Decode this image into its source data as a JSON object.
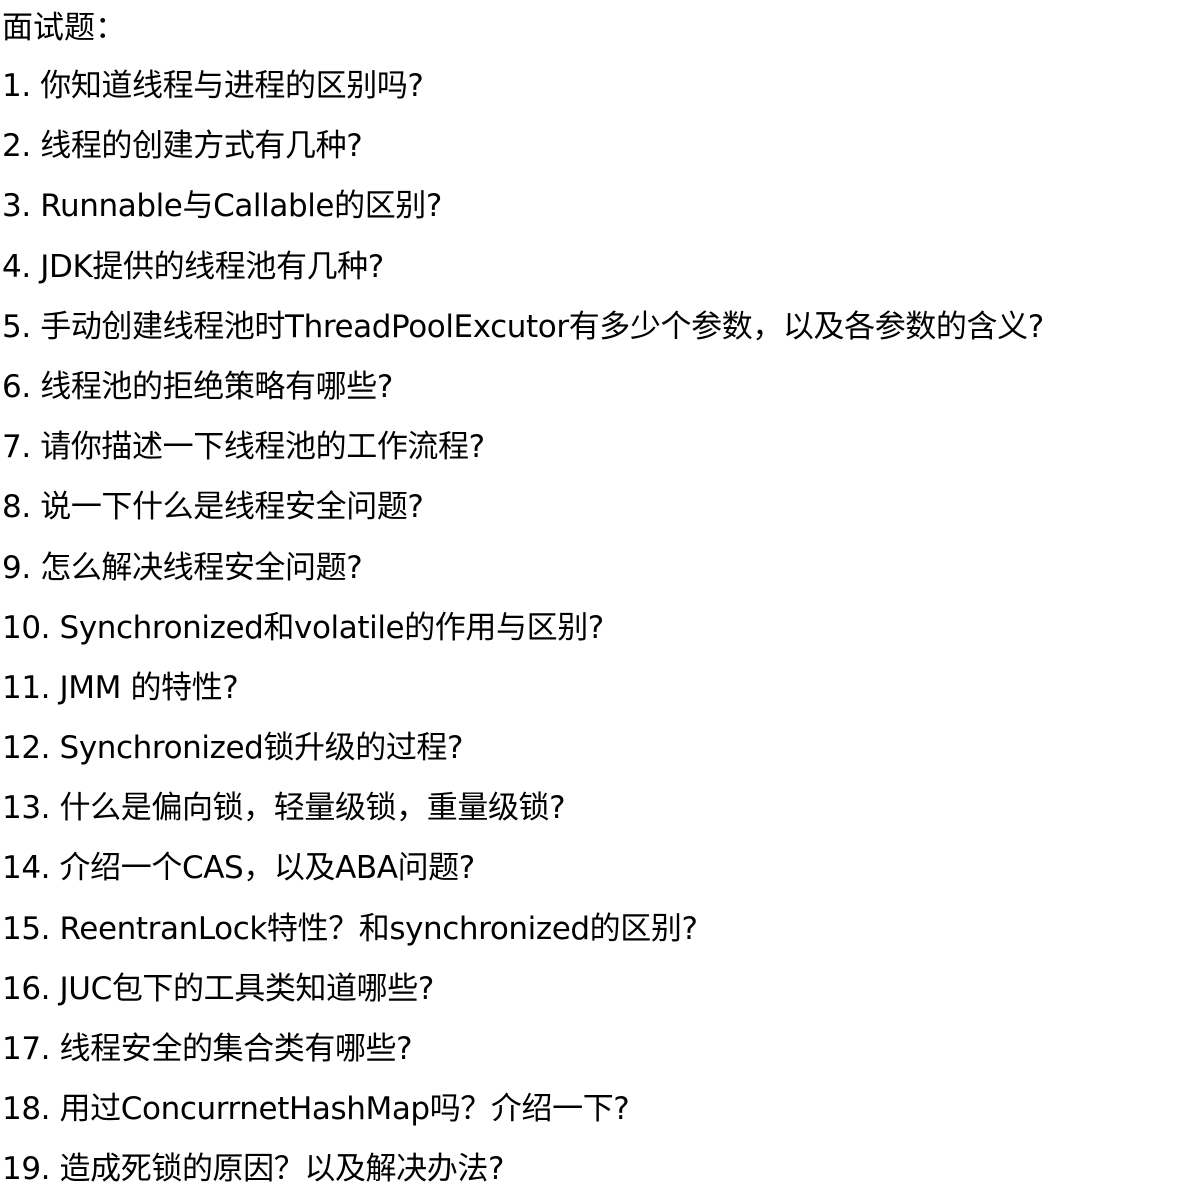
{
  "document": {
    "title": "面试题：",
    "questions": [
      "1. 你知道线程与进程的区别吗?",
      "2. 线程的创建方式有几种?",
      "3. Runnable与Callable的区别?",
      "4. JDK提供的线程池有几种?",
      "5. 手动创建线程池时ThreadPoolExcutor有多少个参数，以及各参数的含义?",
      "6. 线程池的拒绝策略有哪些?",
      "7. 请你描述一下线程池的工作流程?",
      "8. 说一下什么是线程安全问题?",
      "9. 怎么解决线程安全问题?",
      "10. Synchronized和volatile的作用与区别?",
      "11. JMM 的特性?",
      "12. Synchronized锁升级的过程?",
      "13. 什么是偏向锁，轻量级锁，重量级锁?",
      "14. 介绍一个CAS，以及ABA问题?",
      "15. ReentranLock特性？和synchronized的区别?",
      "16. JUC包下的工具类知道哪些?",
      "17. 线程安全的集合类有哪些?",
      "18. 用过ConcurrnetHashMap吗？介绍一下?",
      "19. 造成死锁的原因？以及解决办法?"
    ]
  }
}
